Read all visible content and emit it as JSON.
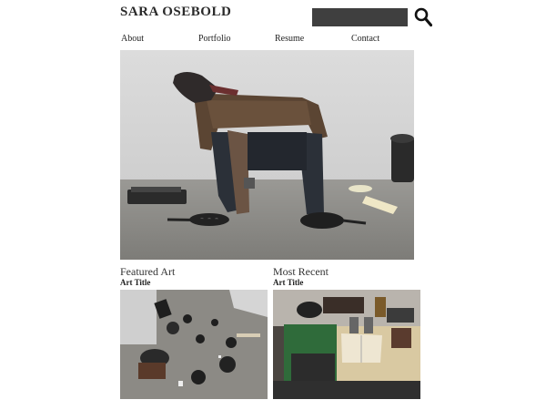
{
  "site": {
    "title": "SARA OSEBOLD"
  },
  "search": {
    "placeholder": ""
  },
  "nav": {
    "items": [
      {
        "label": "About"
      },
      {
        "label": "Portfolio"
      },
      {
        "label": "Resume"
      },
      {
        "label": "Contact"
      }
    ]
  },
  "featured": {
    "heading": "Featured Art",
    "title": "Art Title"
  },
  "recent": {
    "heading": "Most Recent",
    "title": "Art Title"
  },
  "icons": {
    "search": "search-icon"
  },
  "colors": {
    "search_bg": "#3f3f3f",
    "text": "#222222"
  }
}
